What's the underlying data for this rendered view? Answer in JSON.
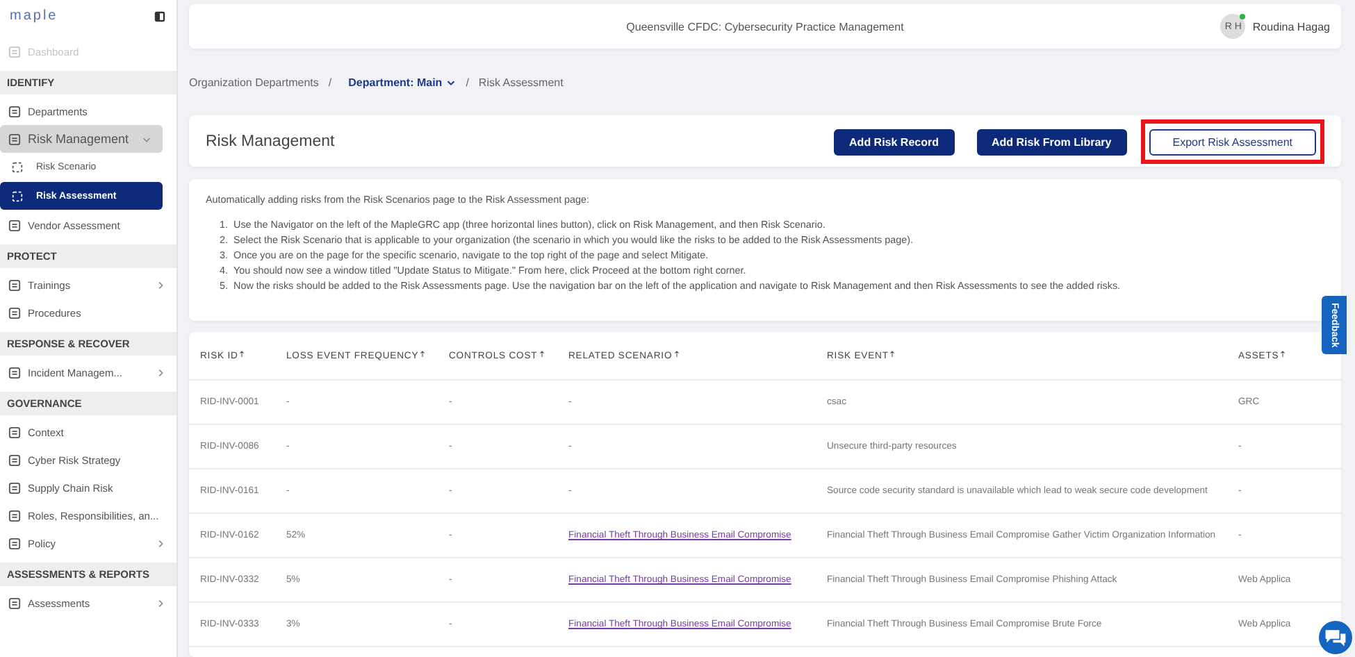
{
  "sidebar": {
    "logo": "maple",
    "items": [
      {
        "kind": "item",
        "label": "Dashboard",
        "disabled": true
      },
      {
        "kind": "section",
        "label": "IDENTIFY"
      },
      {
        "kind": "item",
        "label": "Departments"
      },
      {
        "kind": "group",
        "label": "Risk Management",
        "expanded": true,
        "children": [
          {
            "kind": "sub",
            "label": "Risk Scenario",
            "selected": false
          },
          {
            "kind": "sub",
            "label": "Risk Assessment",
            "selected": true
          }
        ]
      },
      {
        "kind": "item",
        "label": "Vendor Assessment"
      },
      {
        "kind": "section",
        "label": "PROTECT"
      },
      {
        "kind": "group",
        "label": "Trainings",
        "expanded": false
      },
      {
        "kind": "item",
        "label": "Procedures"
      },
      {
        "kind": "section",
        "label": "RESPONSE & RECOVER"
      },
      {
        "kind": "group",
        "label": "Incident Managem...",
        "expanded": false
      },
      {
        "kind": "section",
        "label": "GOVERNANCE"
      },
      {
        "kind": "item",
        "label": "Context"
      },
      {
        "kind": "item",
        "label": "Cyber Risk Strategy"
      },
      {
        "kind": "item",
        "label": "Supply Chain Risk"
      },
      {
        "kind": "item",
        "label": "Roles, Responsibilities, an..."
      },
      {
        "kind": "group",
        "label": "Policy",
        "expanded": false
      },
      {
        "kind": "section",
        "label": "ASSESSMENTS & REPORTS"
      },
      {
        "kind": "group",
        "label": "Assessments",
        "expanded": false
      }
    ]
  },
  "header": {
    "title": "Queensville CFDC: Cybersecurity Practice Management",
    "user": {
      "initials": "R H",
      "name": "Roudina Hagag",
      "online": true
    }
  },
  "breadcrumb": {
    "separator": "/",
    "items": [
      {
        "label": "Organization Departments",
        "kind": "link"
      },
      {
        "label": "Department: Main",
        "kind": "dropdown"
      },
      {
        "label": "Risk Assessment",
        "kind": "current"
      }
    ]
  },
  "page": {
    "title": "Risk Management",
    "buttons": [
      {
        "label": "Add Risk Record",
        "kind": "primary",
        "highlighted": false
      },
      {
        "label": "Add Risk From Library",
        "kind": "primary",
        "highlighted": false
      },
      {
        "label": "Export Risk Assessment",
        "kind": "outline",
        "highlighted": true
      }
    ]
  },
  "instructions": {
    "intro": "Automatically adding risks from the Risk Scenarios page to the Risk Assessment page:",
    "steps": [
      {
        "number": "1.",
        "text": "Use the Navigator on the left of the MapleGRC app (three horizontal lines button), click on Risk Management, and then Risk Scenario."
      },
      {
        "number": "2.",
        "text": "Select the Risk Scenario that is applicable to your organization (the scenario in which you would like the risks to be added to the Risk Assessments page)."
      },
      {
        "number": "3.",
        "text": "Once you are on the page for the specific scenario, navigate to the top right of the page and select Mitigate."
      },
      {
        "number": "4.",
        "text": "You should now see a window titled \"Update Status to Mitigate.\" From here, click Proceed at the bottom right corner."
      },
      {
        "number": "5.",
        "text": "Now the risks should be added to the Risk Assessments page. Use the navigation bar on the left of the application and navigate to Risk Management and then Risk Assessments to see the added risks."
      }
    ]
  },
  "table": {
    "columns": [
      "RISK ID",
      "LOSS EVENT FREQUENCY",
      "CONTROLS COST",
      "RELATED SCENARIO",
      "RISK EVENT",
      "ASSETS"
    ],
    "rows": [
      [
        "RID-INV-0001",
        "-",
        "-",
        "-",
        "csac",
        "GRC"
      ],
      [
        "RID-INV-0086",
        "-",
        "-",
        "-",
        "Unsecure third-party resources",
        "-"
      ],
      [
        "RID-INV-0161",
        "-",
        "-",
        "-",
        "Source code security standard is unavailable which lead to weak secure code development",
        "-"
      ],
      [
        "RID-INV-0162",
        "52%",
        "-",
        "Financial Theft Through Business Email Compromise",
        "Financial Theft Through Business Email Compromise Gather Victim Organization Information",
        "-"
      ],
      [
        "RID-INV-0332",
        "5%",
        "-",
        "Financial Theft Through Business Email Compromise",
        "Financial Theft Through Business Email Compromise Phishing Attack",
        "Web Applica"
      ],
      [
        "RID-INV-0333",
        "3%",
        "-",
        "Financial Theft Through Business Email Compromise",
        "Financial Theft Through Business Email Compromise Brute Force",
        "Web Applica"
      ]
    ]
  },
  "feedback": {
    "label": "Feedback"
  }
}
